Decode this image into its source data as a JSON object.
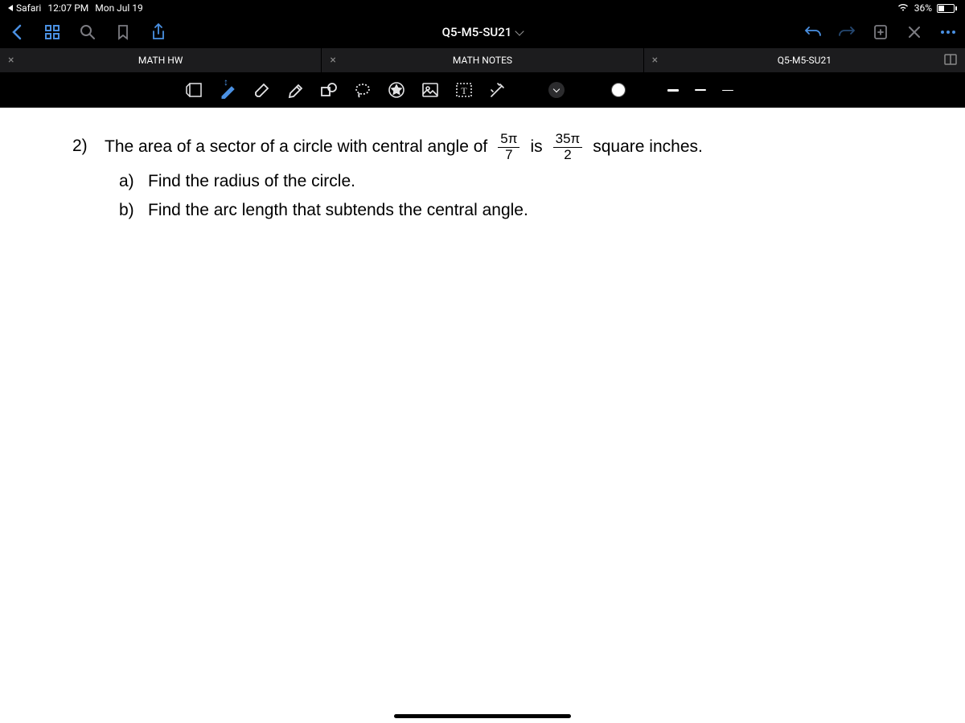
{
  "status": {
    "back_app": "Safari",
    "time": "12:07 PM",
    "date": "Mon Jul 19",
    "battery_pct": "36%"
  },
  "nav": {
    "title": "Q5-M5-SU21"
  },
  "tabs": [
    {
      "label": "MATH HW"
    },
    {
      "label": "MATH NOTES"
    },
    {
      "label": "Q5-M5-SU21"
    }
  ],
  "problem": {
    "number": "2)",
    "text_before": "The area of a sector of a circle with central angle of",
    "frac1_num": "5π",
    "frac1_den": "7",
    "text_middle": "is",
    "frac2_num": "35π",
    "frac2_den": "2",
    "text_after": "square inches.",
    "parts": [
      {
        "label": "a)",
        "text": "Find the radius of the circle."
      },
      {
        "label": "b)",
        "text": "Find the arc length that subtends the central angle."
      }
    ]
  }
}
